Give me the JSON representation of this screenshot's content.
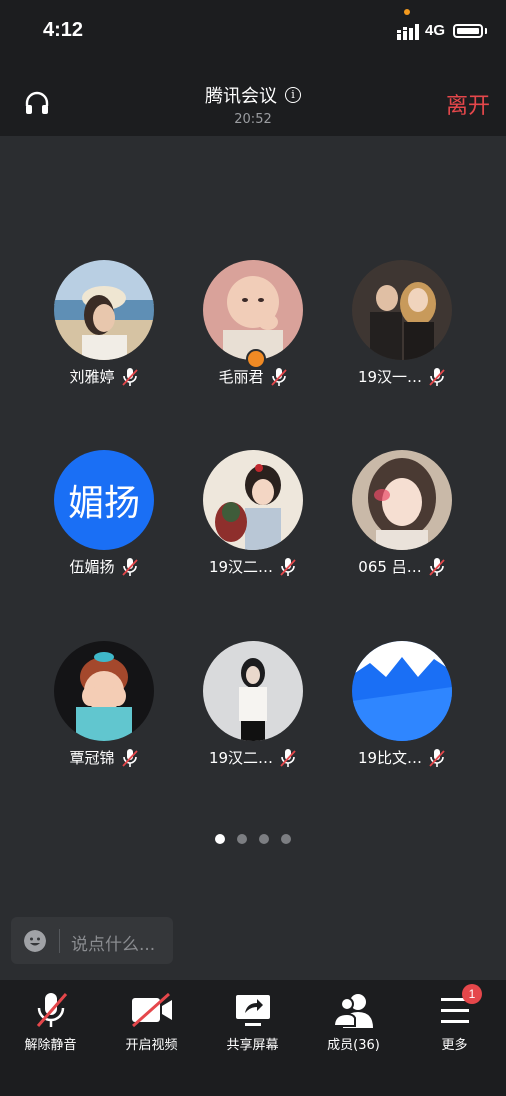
{
  "status": {
    "time": "4:12",
    "network": "4G",
    "dot_color": "#f39a1e"
  },
  "header": {
    "title": "腾讯会议",
    "timer": "20:52",
    "leave_label": "离开",
    "leave_color": "#e5474b"
  },
  "participants": [
    {
      "name": "刘雅婷",
      "muted": true,
      "avatar": "photo-beach"
    },
    {
      "name": "毛丽君",
      "muted": true,
      "avatar": "photo-baby",
      "host": true
    },
    {
      "name": "19汉一…",
      "muted": true,
      "avatar": "photo-couple"
    },
    {
      "name": "伍媚扬",
      "muted": true,
      "avatar": "text-avatar",
      "avatar_text": "媚扬",
      "avatar_color": "#1a6ff5"
    },
    {
      "name": "19汉二…",
      "muted": true,
      "avatar": "photo-illustration"
    },
    {
      "name": "065 吕…",
      "muted": true,
      "avatar": "photo-girl"
    },
    {
      "name": "覃冠锦",
      "muted": true,
      "avatar": "cartoon-wendy"
    },
    {
      "name": "19汉二…",
      "muted": true,
      "avatar": "photo-bw-girl"
    },
    {
      "name": "19比文…",
      "muted": true,
      "avatar": "blue-mountain-logo"
    }
  ],
  "pagination": {
    "pages": 4,
    "current": 1
  },
  "chat": {
    "placeholder": "说点什么..."
  },
  "toolbar": {
    "unmute": "解除静音",
    "video": "开启视频",
    "share": "共享屏幕",
    "members": "成员(36)",
    "more": "更多",
    "more_badge": "1"
  }
}
